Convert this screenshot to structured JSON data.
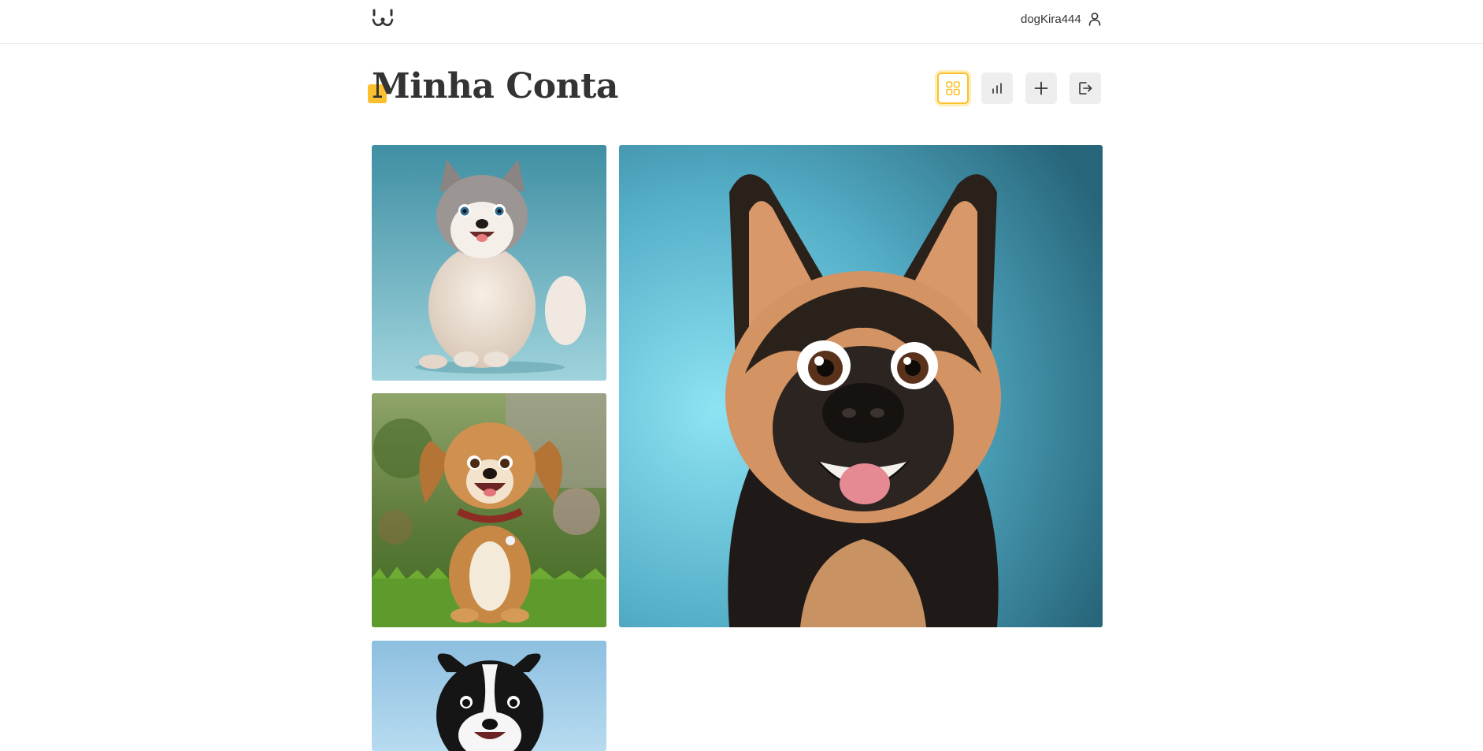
{
  "header": {
    "logo_icon": "dog-face-logo-icon",
    "username": "dogKira444",
    "user_icon": "user-icon"
  },
  "page": {
    "title": "Minha Conta",
    "accent_color": "#fbc02d"
  },
  "toolbar": {
    "buttons": [
      {
        "icon": "grid-icon",
        "active": true
      },
      {
        "icon": "bar-chart-icon",
        "active": false
      },
      {
        "icon": "plus-icon",
        "active": false
      },
      {
        "icon": "logout-icon",
        "active": false
      }
    ]
  },
  "feed": {
    "photos": [
      {
        "subject": "fluffy-husky-puppy"
      },
      {
        "subject": "brown-puppy-in-grass"
      },
      {
        "subject": "german-shepherd-portrait"
      },
      {
        "subject": "border-collie-puppy"
      }
    ]
  }
}
